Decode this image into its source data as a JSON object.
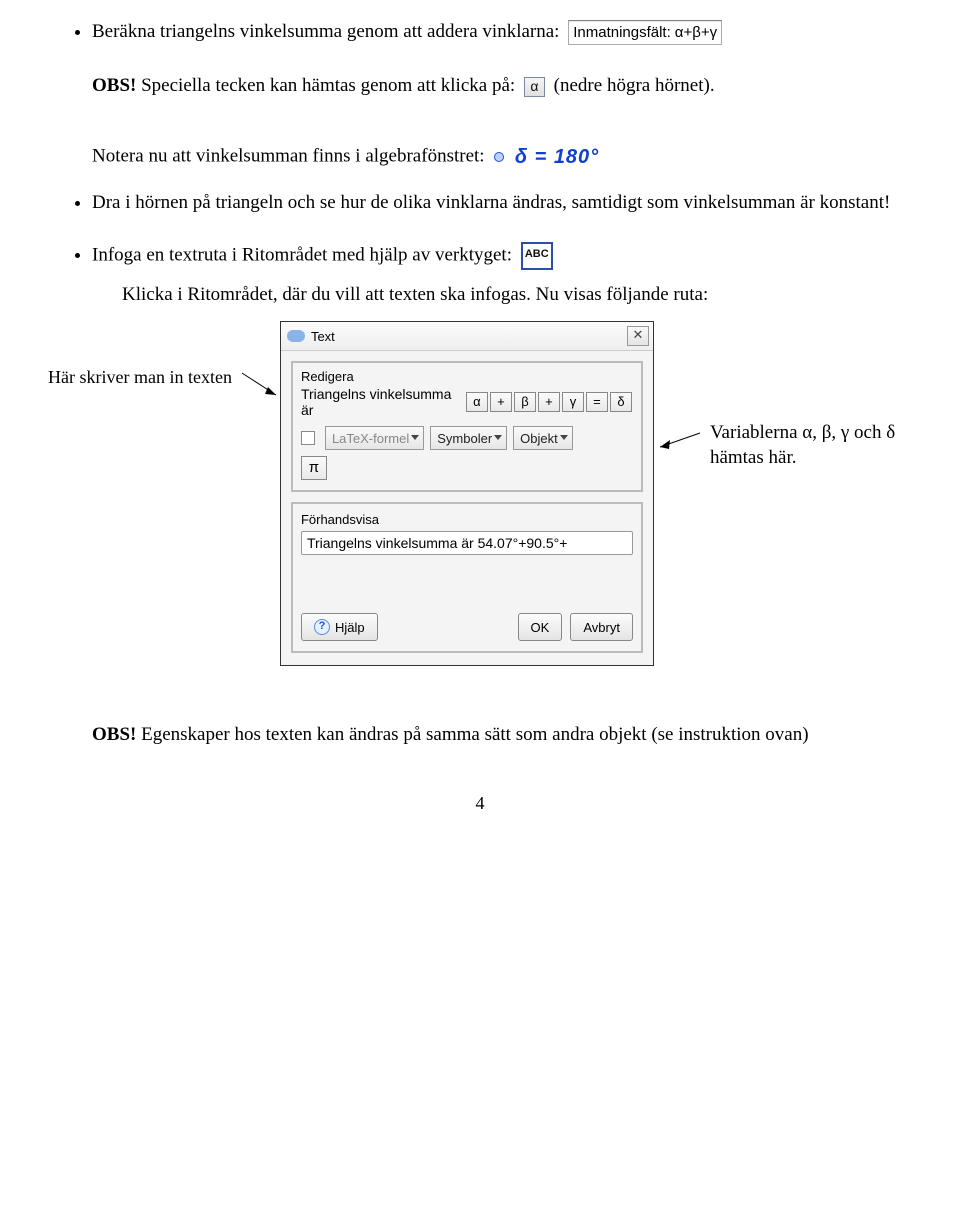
{
  "bullets": {
    "b1": "Beräkna triangelns vinkelsumma genom att addera vinklarna:",
    "b2": "Dra i hörnen på triangeln och se hur de olika vinklarna ändras, samtidigt som vinkelsumman är konstant!",
    "b3": "Infoga en textruta i Ritområdet med hjälp av verktyget:"
  },
  "input_widget": {
    "label": "Inmatningsfält:",
    "value": "α+β+γ"
  },
  "obs": "OBS!",
  "obs_line": "Speciella tecken kan hämtas genom att klicka på:",
  "obs_suffix": "(nedre högra hörnet).",
  "alpha_btn": "α",
  "notera": "Notera nu att vinkelsumman finns i algebrafönstret:",
  "delta_eq": "δ = 180°",
  "abc": "ABC",
  "klicka": "Klicka i Ritområdet, där du vill att texten ska infogas. Nu visas följande ruta:",
  "left_annot": "Här skriver man in texten",
  "right_annot1": "Variablerna α, β, γ och δ",
  "right_annot2": "hämtas här.",
  "dialog": {
    "title": "Text",
    "close": "✕",
    "redigera": "Redigera",
    "formula_prefix": "Triangelns vinkelsumma är",
    "chips": [
      "α",
      "+",
      "β",
      "+",
      "γ",
      "=",
      "δ"
    ],
    "latex": "LaTeX-formel",
    "symboler": "Symboler",
    "objekt": "Objekt",
    "pi": "π",
    "forhands": "Förhandsvisa",
    "preview": "Triangelns vinkelsumma är 54.07°+90.5°+",
    "help": "Hjälp",
    "ok": "OK",
    "avbryt": "Avbryt"
  },
  "obs2": "Egenskaper hos texten kan ändras på samma sätt som andra objekt (se instruktion ovan)",
  "page": "4"
}
